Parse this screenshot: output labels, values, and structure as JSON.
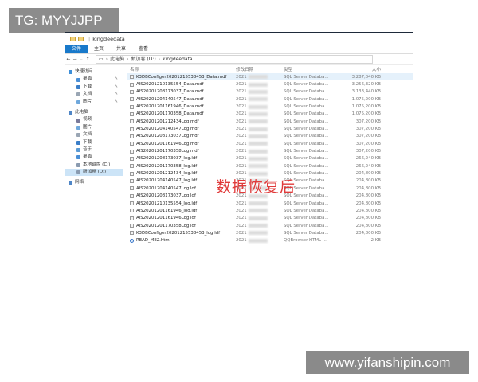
{
  "badge": {
    "text": "TG: MYYJJPP"
  },
  "window": {
    "title": "kingdeedata"
  },
  "ribbon": {
    "tabs": [
      "文件",
      "主页",
      "共享",
      "查看"
    ]
  },
  "address": {
    "crumbs": [
      "此电脑",
      "新加卷 (D:)",
      "kingdeedata"
    ]
  },
  "sidebar": {
    "quick_access": "快速访问",
    "quick_items": [
      "桌面",
      "下载",
      "文档",
      "图片"
    ],
    "this_pc": "此电脑",
    "pc_items": [
      "视频",
      "图片",
      "文档",
      "下载",
      "音乐",
      "桌面",
      "本地磁盘 (C:)",
      "新加卷 (D:)"
    ],
    "network": "网络"
  },
  "columns": {
    "name": "名称",
    "date": "修改日期",
    "type": "类型",
    "size": "大小"
  },
  "files": [
    {
      "name": "K3DBConfiger20201215538453_Data.mdf",
      "date": "2021",
      "type": "SQL Server Databa...",
      "size": "3,287,040 KB"
    },
    {
      "name": "AIS20201210135554_Data.mdf",
      "date": "2021",
      "type": "SQL Server Databa...",
      "size": "3,256,320 KB"
    },
    {
      "name": "AIS20201208173037_Data.mdf",
      "date": "2021",
      "type": "SQL Server Databa...",
      "size": "3,133,440 KB"
    },
    {
      "name": "AIS20201204140547_Data.mdf",
      "date": "2021",
      "type": "SQL Server Databa...",
      "size": "1,075,200 KB"
    },
    {
      "name": "AIS20201201161946_Data.mdf",
      "date": "2021",
      "type": "SQL Server Databa...",
      "size": "1,075,200 KB"
    },
    {
      "name": "AIS20201201170358_Data.mdf",
      "date": "2021",
      "type": "SQL Server Databa...",
      "size": "1,075,200 KB"
    },
    {
      "name": "AIS20201201212434Log.mdf",
      "date": "2021",
      "type": "SQL Server Databa...",
      "size": "307,200 KB"
    },
    {
      "name": "AIS20201204140547Log.mdf",
      "date": "2021",
      "type": "SQL Server Databa...",
      "size": "307,200 KB"
    },
    {
      "name": "AIS20201208173037Log.mdf",
      "date": "2021",
      "type": "SQL Server Databa...",
      "size": "307,200 KB"
    },
    {
      "name": "AIS20201201161946Log.mdf",
      "date": "2021",
      "type": "SQL Server Databa...",
      "size": "307,200 KB"
    },
    {
      "name": "AIS20201201170358Log.mdf",
      "date": "2021",
      "type": "SQL Server Databa...",
      "size": "307,200 KB"
    },
    {
      "name": "AIS20201208173037_log.ldf",
      "date": "2021",
      "type": "SQL Server Databa...",
      "size": "266,240 KB"
    },
    {
      "name": "AIS20201201170358_log.ldf",
      "date": "2021",
      "type": "SQL Server Databa...",
      "size": "266,240 KB"
    },
    {
      "name": "AIS20201201212434_log.ldf",
      "date": "2021",
      "type": "SQL Server Databa...",
      "size": "204,800 KB"
    },
    {
      "name": "AIS20201204140547_log.ldf",
      "date": "2021",
      "type": "SQL Server Databa...",
      "size": "204,800 KB"
    },
    {
      "name": "AIS20201204140547Log.ldf",
      "date": "2021",
      "type": "SQL Server Databa...",
      "size": "204,800 KB"
    },
    {
      "name": "AIS20201208173037Log.ldf",
      "date": "2021",
      "type": "SQL Server Databa...",
      "size": "204,800 KB"
    },
    {
      "name": "AIS20201210135554_log.ldf",
      "date": "2021",
      "type": "SQL Server Databa...",
      "size": "204,800 KB"
    },
    {
      "name": "AIS20201201161946_log.ldf",
      "date": "2021",
      "type": "SQL Server Databa...",
      "size": "204,800 KB"
    },
    {
      "name": "AIS20201201161946Log.ldf",
      "date": "2021",
      "type": "SQL Server Databa...",
      "size": "204,800 KB"
    },
    {
      "name": "AIS20201201170358Log.ldf",
      "date": "2021",
      "type": "SQL Server Databa...",
      "size": "204,800 KB"
    },
    {
      "name": "K3DBConfiger20201215538453_log.ldf",
      "date": "2021",
      "type": "SQL Server Databa...",
      "size": "204,800 KB"
    },
    {
      "name": "READ_ME2.html",
      "date": "2021",
      "type": "QQBrowser HTML ...",
      "size": "2 KB"
    }
  ],
  "overlay": {
    "text": "数据恢复后"
  },
  "watermark": {
    "text": "www.yifanshipin.com"
  },
  "colors": {
    "accent": "#1979ca",
    "overlay": "#e03a3a",
    "badge_bg": "#8c8c8c"
  }
}
